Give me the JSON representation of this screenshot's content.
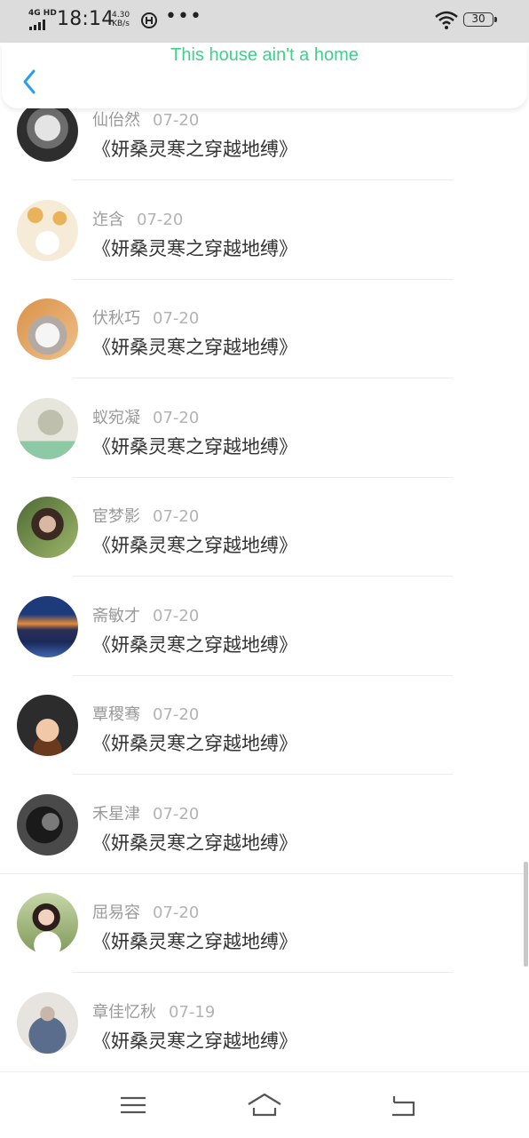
{
  "status_bar": {
    "network": "4G HD",
    "time": "18:14",
    "speed_value": "4.30",
    "speed_unit": "KB/s",
    "dots": "•••",
    "battery": "30"
  },
  "header": {
    "title": "This house ain't a home",
    "back_icon": "chevron-left-icon"
  },
  "colors": {
    "title_green": "#3fd08a",
    "back_blue": "#2a9df4",
    "text_dark": "#333333",
    "text_gray": "#9a9a9a"
  },
  "items": [
    {
      "name": "仙佁然",
      "date": "07-20",
      "book": "《妍桑灵寒之穿越地缚》"
    },
    {
      "name": "迮含",
      "date": "07-20",
      "book": "《妍桑灵寒之穿越地缚》"
    },
    {
      "name": "伏秋巧",
      "date": "07-20",
      "book": "《妍桑灵寒之穿越地缚》"
    },
    {
      "name": "蚁宛凝",
      "date": "07-20",
      "book": "《妍桑灵寒之穿越地缚》"
    },
    {
      "name": "宦梦影",
      "date": "07-20",
      "book": "《妍桑灵寒之穿越地缚》"
    },
    {
      "name": "斋敏才",
      "date": "07-20",
      "book": "《妍桑灵寒之穿越地缚》"
    },
    {
      "name": "覃稷骞",
      "date": "07-20",
      "book": "《妍桑灵寒之穿越地缚》"
    },
    {
      "name": "禾星津",
      "date": "07-20",
      "book": "《妍桑灵寒之穿越地缚》"
    },
    {
      "name": "屈易容",
      "date": "07-20",
      "book": "《妍桑灵寒之穿越地缚》"
    },
    {
      "name": "章佳忆秋",
      "date": "07-19",
      "book": "《妍桑灵寒之穿越地缚》"
    }
  ],
  "navbar": {
    "menu_icon": "menu-icon",
    "home_icon": "home-icon",
    "back_icon": "back-icon"
  }
}
